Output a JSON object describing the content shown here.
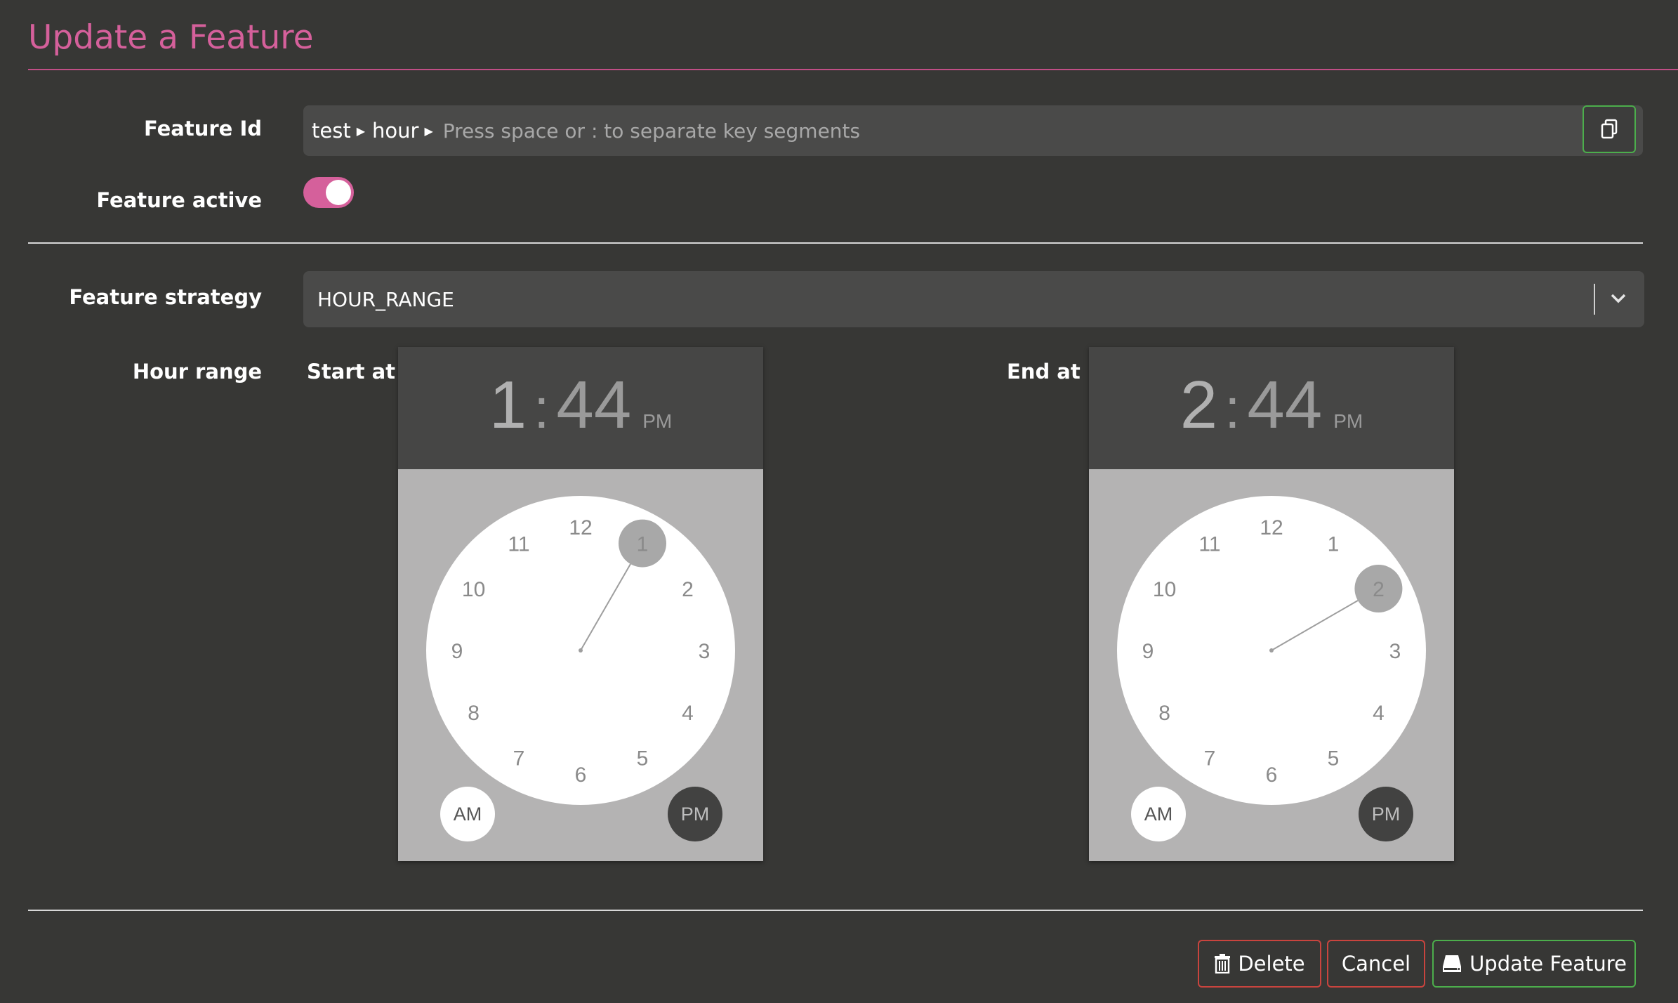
{
  "title": "Update a Feature",
  "form": {
    "feature_id_label": "Feature Id",
    "feature_id_segments": [
      "test",
      "hour"
    ],
    "feature_id_placeholder": "Press space or : to separate key segments",
    "feature_active_label": "Feature active",
    "feature_active": true,
    "strategy_label": "Feature strategy",
    "strategy_value": "HOUR_RANGE",
    "hour_range_label": "Hour range",
    "start_label": "Start at",
    "end_label": "End at"
  },
  "start_clock": {
    "hour": "1",
    "colon": ":",
    "minute": "44",
    "period": "PM",
    "selected_hour": 1,
    "dial_numbers": [
      "12",
      "1",
      "2",
      "3",
      "4",
      "5",
      "6",
      "7",
      "8",
      "9",
      "10",
      "11"
    ],
    "am_label": "AM",
    "pm_label": "PM"
  },
  "end_clock": {
    "hour": "2",
    "colon": ":",
    "minute": "44",
    "period": "PM",
    "selected_hour": 2,
    "dial_numbers": [
      "12",
      "1",
      "2",
      "3",
      "4",
      "5",
      "6",
      "7",
      "8",
      "9",
      "10",
      "11"
    ],
    "am_label": "AM",
    "pm_label": "PM"
  },
  "buttons": {
    "delete": "Delete",
    "cancel": "Cancel",
    "update": "Update Feature"
  },
  "colors": {
    "accent": "#d5609b",
    "danger": "#c9443e",
    "success": "#4cae4c"
  },
  "icons": {
    "copy": "copy-icon",
    "trash": "trash-icon",
    "save": "save-icon",
    "chevron": "chevron-down-icon"
  }
}
